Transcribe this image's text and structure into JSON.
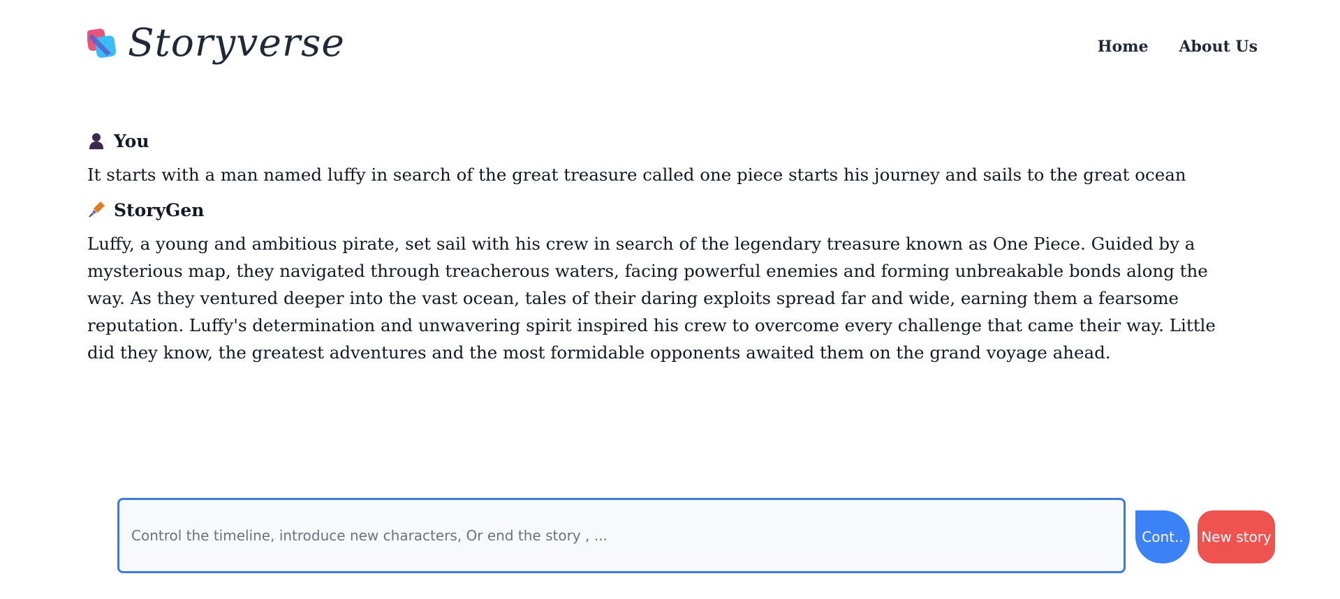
{
  "header": {
    "brand": "Storyverse",
    "nav": [
      {
        "label": "Home"
      },
      {
        "label": "About Us"
      }
    ]
  },
  "conversation": {
    "user": {
      "name": "You",
      "icon": "user-icon",
      "message": "It starts with a man named luffy in search of the great treasure called one piece starts his journey and sails to the great ocean"
    },
    "bot": {
      "name": "StoryGen",
      "icon": "pen-nib-icon",
      "message": "Luffy, a young and ambitious pirate, set sail with his crew in search of the legendary treasure known as One Piece. Guided by a mysterious map, they navigated through treacherous waters, facing powerful enemies and forming unbreakable bonds along the way. As they ventured deeper into the vast ocean, tales of their daring exploits spread far and wide, earning them a fearsome reputation. Luffy's determination and unwavering spirit inspired his crew to overcome every challenge that came their way. Little did they know, the greatest adventures and the most formidable opponents awaited them on the grand voyage ahead."
    }
  },
  "composer": {
    "value": "",
    "placeholder": "Control the timeline, introduce new characters, Or end the story , ...",
    "continue_label": "Cont..",
    "new_story_label": "New story"
  },
  "colors": {
    "accent_blue": "#3b82f6",
    "input_border": "#3b7be0",
    "new_story_red": "#ef5350",
    "logo_pink": "#e8547a",
    "logo_cyan": "#38bdf8",
    "logo_indigo": "#5b5fc7"
  }
}
